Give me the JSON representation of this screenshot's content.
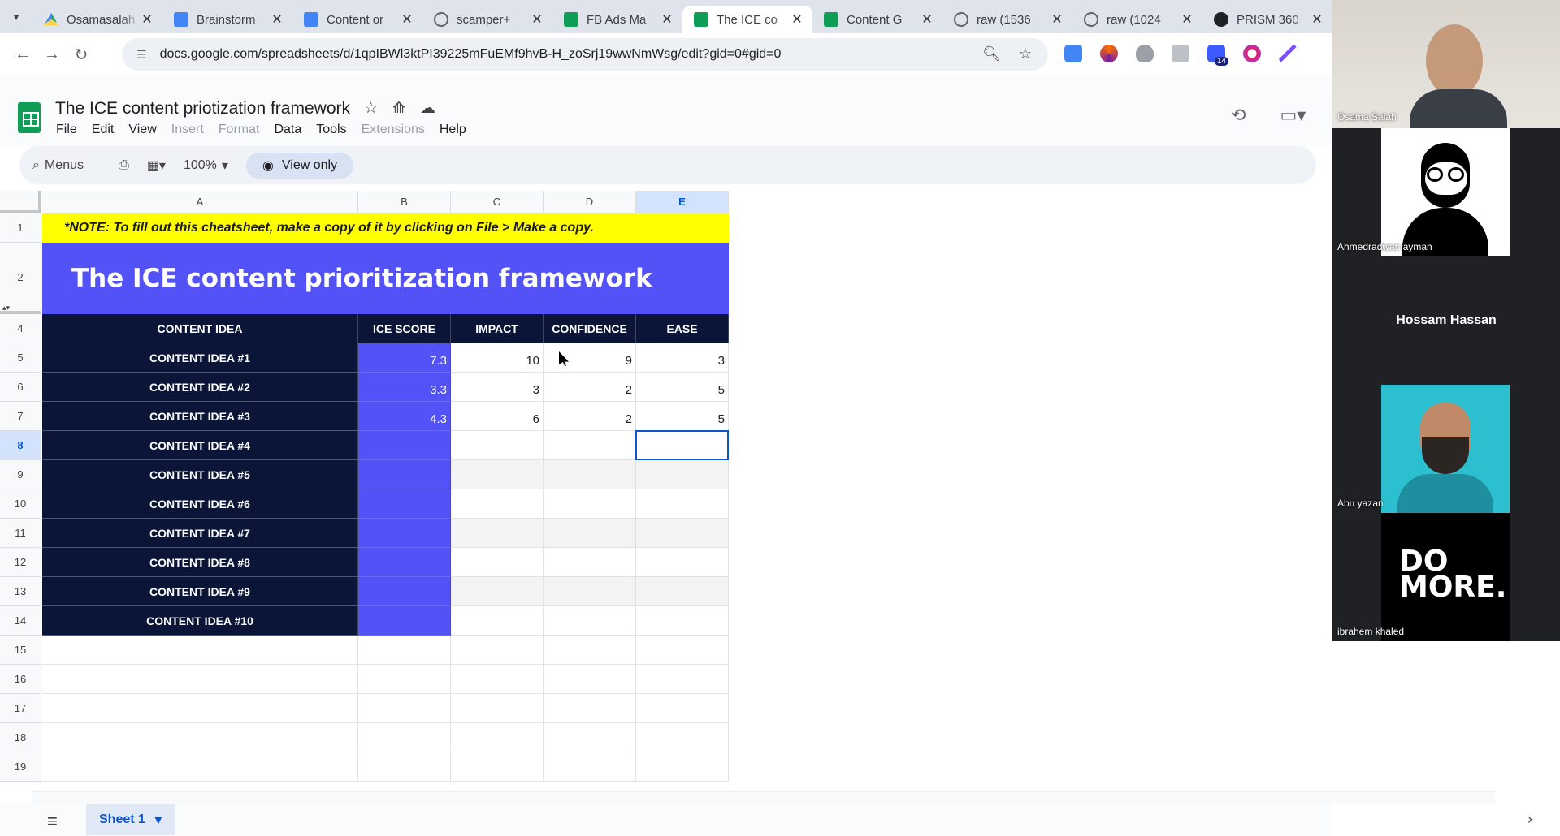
{
  "browser": {
    "tabs": [
      {
        "title": "Osamasalah",
        "favicon": "drive-icon",
        "kind": "drive"
      },
      {
        "title": "Brainstorm",
        "favicon": "docs-icon",
        "kind": "docs"
      },
      {
        "title": "Content or",
        "favicon": "docs-icon",
        "kind": "docs"
      },
      {
        "title": "scamper+",
        "favicon": "globe-icon",
        "kind": "globe"
      },
      {
        "title": "FB Ads Ma",
        "favicon": "sheets-icon",
        "kind": "sheets"
      },
      {
        "title": "The ICE co",
        "favicon": "sheets-icon",
        "kind": "sheets",
        "active": true
      },
      {
        "title": "Content G",
        "favicon": "sheets-icon",
        "kind": "sheets"
      },
      {
        "title": "raw (1536",
        "favicon": "globe-icon",
        "kind": "globe"
      },
      {
        "title": "raw (1024",
        "favicon": "globe-icon",
        "kind": "globe"
      },
      {
        "title": "PRISM 360",
        "favicon": "prism-icon",
        "kind": "prism"
      }
    ],
    "url": "docs.google.com/spreadsheets/d/1qpIBWl3ktPI39225mFuEMf9hvB-H_zoSrj19wwNmWsg/edit?gid=0#gid=0",
    "extension_badge": "14"
  },
  "sheet": {
    "title": "The ICE content priotization framework",
    "menu": [
      {
        "label": "File",
        "enabled": true
      },
      {
        "label": "Edit",
        "enabled": true
      },
      {
        "label": "View",
        "enabled": true
      },
      {
        "label": "Insert",
        "enabled": false
      },
      {
        "label": "Format",
        "enabled": false
      },
      {
        "label": "Extensions",
        "enabled": false
      },
      {
        "label": "Data",
        "enabled": true
      },
      {
        "label": "Tools",
        "enabled": true
      },
      {
        "label": "Help",
        "enabled": true
      }
    ],
    "toolbar": {
      "menus_label": "Menus",
      "zoom": "100%",
      "view_only_label": "View only"
    },
    "columns": [
      "A",
      "B",
      "C",
      "D",
      "E"
    ],
    "rows_visible": [
      "1",
      "2",
      "4",
      "5",
      "6",
      "7",
      "8",
      "9",
      "10",
      "11",
      "12",
      "13",
      "14",
      "15",
      "16",
      "17",
      "18",
      "19"
    ],
    "note": "*NOTE: To fill out this cheatsheet, make a copy of it by clicking on File > Make a copy.",
    "banner": "The ICE content prioritization framework",
    "table_headers": [
      "CONTENT IDEA",
      "ICE SCORE",
      "IMPACT",
      "CONFIDENCE",
      "EASE"
    ],
    "table_rows": [
      {
        "idea": "CONTENT IDEA #1",
        "ice": "7.3",
        "impact": "10",
        "confidence": "9",
        "ease": "3"
      },
      {
        "idea": "CONTENT IDEA #2",
        "ice": "3.3",
        "impact": "3",
        "confidence": "2",
        "ease": "5"
      },
      {
        "idea": "CONTENT IDEA #3",
        "ice": "4.3",
        "impact": "6",
        "confidence": "2",
        "ease": "5"
      },
      {
        "idea": "CONTENT IDEA #4",
        "ice": "",
        "impact": "",
        "confidence": "",
        "ease": ""
      },
      {
        "idea": "CONTENT IDEA #5",
        "ice": "",
        "impact": "",
        "confidence": "",
        "ease": ""
      },
      {
        "idea": "CONTENT IDEA #6",
        "ice": "",
        "impact": "",
        "confidence": "",
        "ease": ""
      },
      {
        "idea": "CONTENT IDEA #7",
        "ice": "",
        "impact": "",
        "confidence": "",
        "ease": ""
      },
      {
        "idea": "CONTENT IDEA #8",
        "ice": "",
        "impact": "",
        "confidence": "",
        "ease": ""
      },
      {
        "idea": "CONTENT IDEA #9",
        "ice": "",
        "impact": "",
        "confidence": "",
        "ease": ""
      },
      {
        "idea": "CONTENT IDEA #10",
        "ice": "",
        "impact": "",
        "confidence": "",
        "ease": ""
      }
    ],
    "selected_cell": "E8",
    "sheet_tab": "Sheet 1"
  },
  "meeting": {
    "participants": [
      "Osama Salah",
      "Ahmedradwan ayman",
      "Hossam Hassan",
      "Abu yazan",
      "ibrahem khaled"
    ],
    "logo_text": "DO MORE."
  },
  "colors": {
    "banner": "#5352f6",
    "header_navy": "#0a1537",
    "note_yellow": "#ffff00",
    "selection": "#0b57d0"
  }
}
